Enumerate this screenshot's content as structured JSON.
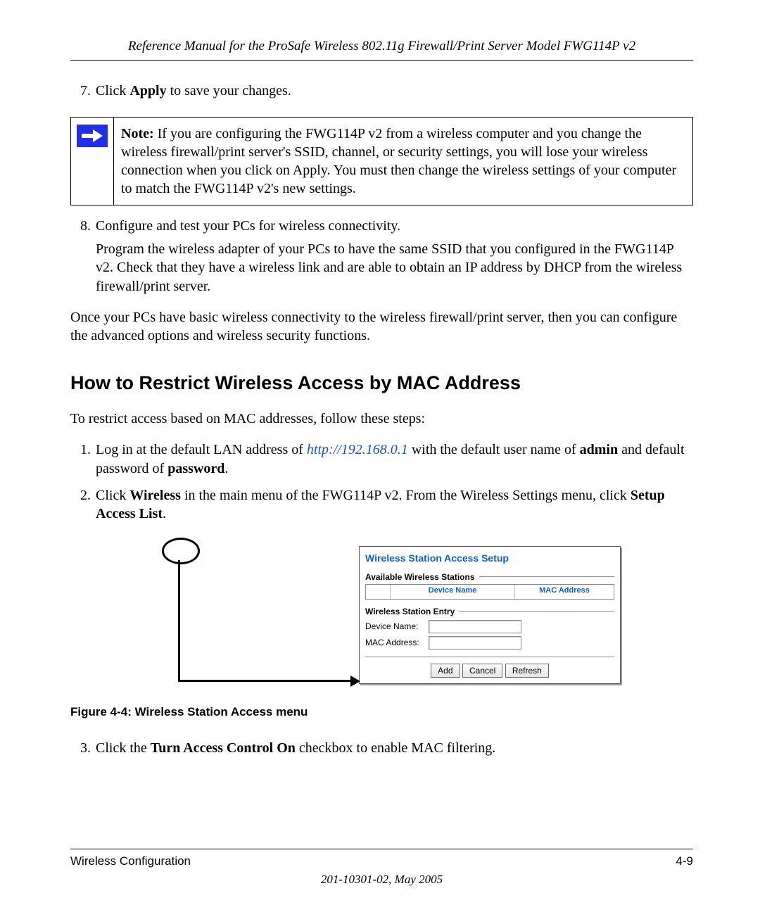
{
  "header": {
    "title": "Reference Manual for the ProSafe Wireless 802.11g  Firewall/Print Server Model FWG114P v2"
  },
  "steps_upper": [
    {
      "n": 7,
      "text_before": "Click ",
      "bold1": "Apply",
      "text_after": " to save your changes."
    }
  ],
  "note": {
    "label": "Note:",
    "text": " If you are configuring the FWG114P v2 from a wireless computer and you change the wireless firewall/print server's SSID, channel, or security settings, you will lose your wireless connection when you click on Apply. You must then change the wireless settings of your computer to match the FWG114P v2's new settings."
  },
  "step8": {
    "n": 8,
    "line1": "Configure and test your PCs for wireless connectivity.",
    "line2": "Program the wireless adapter of your PCs to have the same SSID that you configured in the FWG114P v2. Check that they have a wireless link and are able to obtain an IP address by DHCP from the wireless firewall/print server."
  },
  "para_after": "Once your PCs have basic wireless connectivity to the wireless firewall/print server, then you can configure the advanced options and wireless security functions.",
  "section_heading": "How to Restrict Wireless Access by MAC Address",
  "section_intro": "To restrict access based on MAC addresses, follow these steps:",
  "steps_lower": {
    "s1": {
      "pre": "Log in at the default LAN address of ",
      "link": "http://192.168.0.1",
      "mid": " with the default user name of ",
      "b1": "admin",
      "mid2": " and default password of ",
      "b2": "password",
      "end": "."
    },
    "s2": {
      "pre": "Click ",
      "b1": "Wireless",
      "mid": " in the main menu of the FWG114P v2. From the Wireless Settings menu, click ",
      "b2": "Setup Access List",
      "end": "."
    },
    "s3": {
      "pre": "Click the ",
      "b1": "Turn Access Control On",
      "end": " checkbox to enable MAC filtering."
    }
  },
  "ui": {
    "title": "Wireless Station Access Setup",
    "avail_label": "Available Wireless Stations",
    "th_device": "Device Name",
    "th_mac": "MAC Address",
    "entry_label": "Wireless Station Entry",
    "field_device": "Device Name:",
    "field_mac": "MAC Address:",
    "btn_add": "Add",
    "btn_cancel": "Cancel",
    "btn_refresh": "Refresh"
  },
  "figure_caption": "Figure 4-4:  Wireless Station Access menu",
  "footer": {
    "left": "Wireless Configuration",
    "right": "4-9",
    "docid": "201-10301-02, May 2005"
  }
}
